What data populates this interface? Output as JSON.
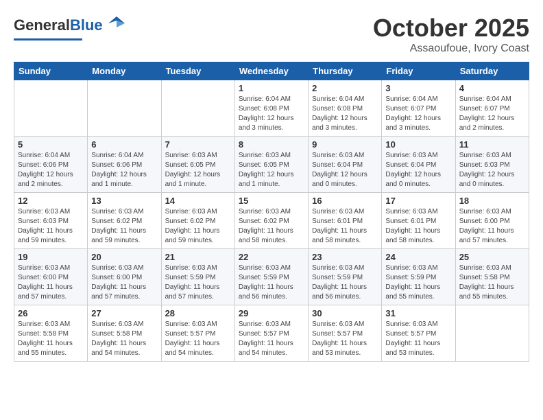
{
  "header": {
    "logo_general": "General",
    "logo_blue": "Blue",
    "month": "October 2025",
    "location": "Assaoufoue, Ivory Coast"
  },
  "days_of_week": [
    "Sunday",
    "Monday",
    "Tuesday",
    "Wednesday",
    "Thursday",
    "Friday",
    "Saturday"
  ],
  "weeks": [
    [
      {
        "day": "",
        "info": ""
      },
      {
        "day": "",
        "info": ""
      },
      {
        "day": "",
        "info": ""
      },
      {
        "day": "1",
        "info": "Sunrise: 6:04 AM\nSunset: 6:08 PM\nDaylight: 12 hours and 3 minutes."
      },
      {
        "day": "2",
        "info": "Sunrise: 6:04 AM\nSunset: 6:08 PM\nDaylight: 12 hours and 3 minutes."
      },
      {
        "day": "3",
        "info": "Sunrise: 6:04 AM\nSunset: 6:07 PM\nDaylight: 12 hours and 3 minutes."
      },
      {
        "day": "4",
        "info": "Sunrise: 6:04 AM\nSunset: 6:07 PM\nDaylight: 12 hours and 2 minutes."
      }
    ],
    [
      {
        "day": "5",
        "info": "Sunrise: 6:04 AM\nSunset: 6:06 PM\nDaylight: 12 hours and 2 minutes."
      },
      {
        "day": "6",
        "info": "Sunrise: 6:04 AM\nSunset: 6:06 PM\nDaylight: 12 hours and 1 minute."
      },
      {
        "day": "7",
        "info": "Sunrise: 6:03 AM\nSunset: 6:05 PM\nDaylight: 12 hours and 1 minute."
      },
      {
        "day": "8",
        "info": "Sunrise: 6:03 AM\nSunset: 6:05 PM\nDaylight: 12 hours and 1 minute."
      },
      {
        "day": "9",
        "info": "Sunrise: 6:03 AM\nSunset: 6:04 PM\nDaylight: 12 hours and 0 minutes."
      },
      {
        "day": "10",
        "info": "Sunrise: 6:03 AM\nSunset: 6:04 PM\nDaylight: 12 hours and 0 minutes."
      },
      {
        "day": "11",
        "info": "Sunrise: 6:03 AM\nSunset: 6:03 PM\nDaylight: 12 hours and 0 minutes."
      }
    ],
    [
      {
        "day": "12",
        "info": "Sunrise: 6:03 AM\nSunset: 6:03 PM\nDaylight: 11 hours and 59 minutes."
      },
      {
        "day": "13",
        "info": "Sunrise: 6:03 AM\nSunset: 6:02 PM\nDaylight: 11 hours and 59 minutes."
      },
      {
        "day": "14",
        "info": "Sunrise: 6:03 AM\nSunset: 6:02 PM\nDaylight: 11 hours and 59 minutes."
      },
      {
        "day": "15",
        "info": "Sunrise: 6:03 AM\nSunset: 6:02 PM\nDaylight: 11 hours and 58 minutes."
      },
      {
        "day": "16",
        "info": "Sunrise: 6:03 AM\nSunset: 6:01 PM\nDaylight: 11 hours and 58 minutes."
      },
      {
        "day": "17",
        "info": "Sunrise: 6:03 AM\nSunset: 6:01 PM\nDaylight: 11 hours and 58 minutes."
      },
      {
        "day": "18",
        "info": "Sunrise: 6:03 AM\nSunset: 6:00 PM\nDaylight: 11 hours and 57 minutes."
      }
    ],
    [
      {
        "day": "19",
        "info": "Sunrise: 6:03 AM\nSunset: 6:00 PM\nDaylight: 11 hours and 57 minutes."
      },
      {
        "day": "20",
        "info": "Sunrise: 6:03 AM\nSunset: 6:00 PM\nDaylight: 11 hours and 57 minutes."
      },
      {
        "day": "21",
        "info": "Sunrise: 6:03 AM\nSunset: 5:59 PM\nDaylight: 11 hours and 57 minutes."
      },
      {
        "day": "22",
        "info": "Sunrise: 6:03 AM\nSunset: 5:59 PM\nDaylight: 11 hours and 56 minutes."
      },
      {
        "day": "23",
        "info": "Sunrise: 6:03 AM\nSunset: 5:59 PM\nDaylight: 11 hours and 56 minutes."
      },
      {
        "day": "24",
        "info": "Sunrise: 6:03 AM\nSunset: 5:59 PM\nDaylight: 11 hours and 55 minutes."
      },
      {
        "day": "25",
        "info": "Sunrise: 6:03 AM\nSunset: 5:58 PM\nDaylight: 11 hours and 55 minutes."
      }
    ],
    [
      {
        "day": "26",
        "info": "Sunrise: 6:03 AM\nSunset: 5:58 PM\nDaylight: 11 hours and 55 minutes."
      },
      {
        "day": "27",
        "info": "Sunrise: 6:03 AM\nSunset: 5:58 PM\nDaylight: 11 hours and 54 minutes."
      },
      {
        "day": "28",
        "info": "Sunrise: 6:03 AM\nSunset: 5:57 PM\nDaylight: 11 hours and 54 minutes."
      },
      {
        "day": "29",
        "info": "Sunrise: 6:03 AM\nSunset: 5:57 PM\nDaylight: 11 hours and 54 minutes."
      },
      {
        "day": "30",
        "info": "Sunrise: 6:03 AM\nSunset: 5:57 PM\nDaylight: 11 hours and 53 minutes."
      },
      {
        "day": "31",
        "info": "Sunrise: 6:03 AM\nSunset: 5:57 PM\nDaylight: 11 hours and 53 minutes."
      },
      {
        "day": "",
        "info": ""
      }
    ]
  ]
}
